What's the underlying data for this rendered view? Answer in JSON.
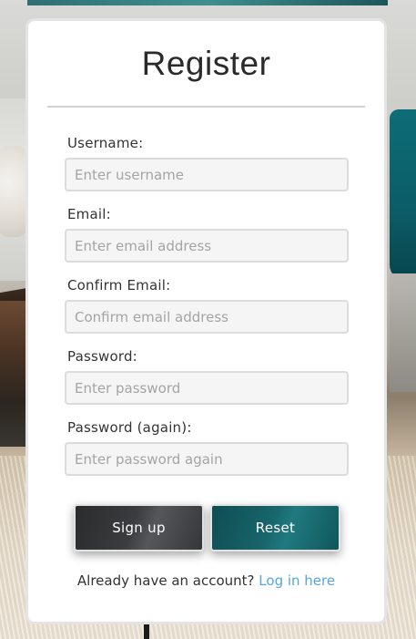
{
  "register_form": {
    "title": "Register",
    "fields": [
      {
        "label": "Username:",
        "placeholder": "Enter username",
        "value": ""
      },
      {
        "label": "Email:",
        "placeholder": "Enter email address",
        "value": ""
      },
      {
        "label": "Confirm Email:",
        "placeholder": "Confirm email address",
        "value": ""
      },
      {
        "label": "Password:",
        "placeholder": "Enter password",
        "value": ""
      },
      {
        "label": "Password (again):",
        "placeholder": "Enter password again",
        "value": ""
      }
    ],
    "signup_label": "Sign up",
    "reset_label": "Reset",
    "footer_text": "Already have an account?",
    "login_link_text": "Log in here"
  },
  "colors": {
    "link": "#55a6de",
    "signup_button": "#3b3c3f",
    "reset_button": "#17656b"
  }
}
